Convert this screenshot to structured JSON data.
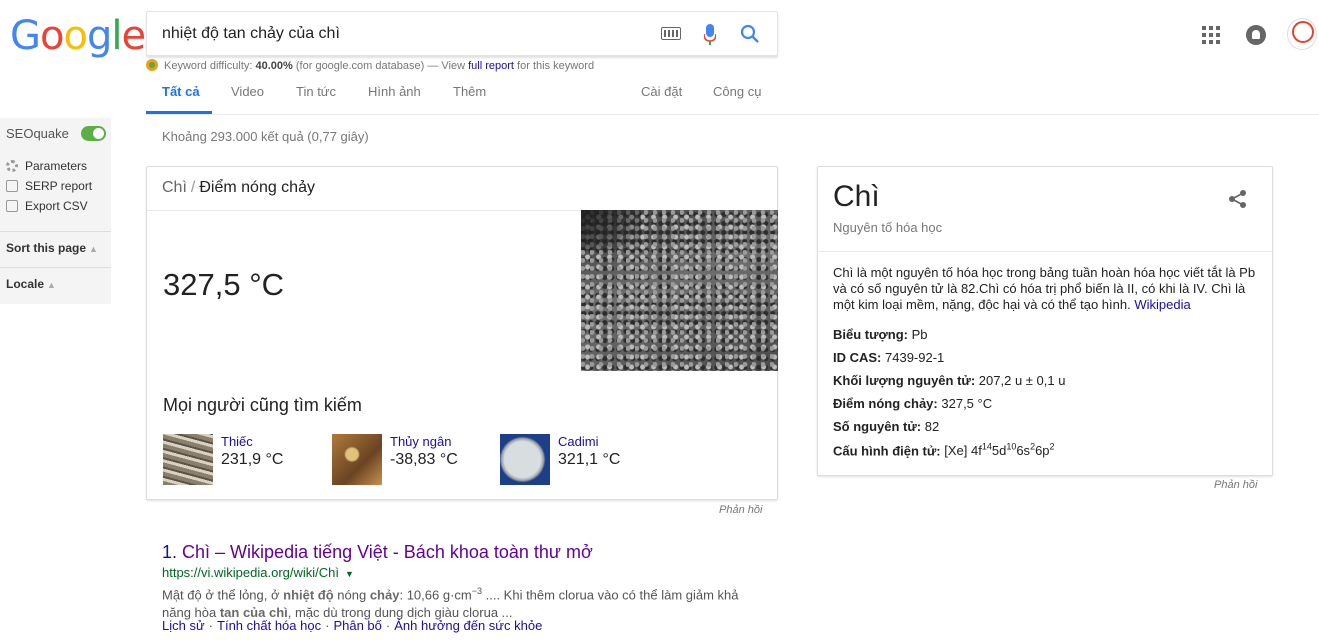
{
  "logo_letters": [
    "G",
    "o",
    "o",
    "g",
    "l",
    "e"
  ],
  "search": {
    "query": "nhiệt độ tan chảy của chì",
    "keyboard_icon": "keyboard-icon",
    "mic_icon": "mic-icon",
    "search_icon": "search-icon"
  },
  "seoquake_bar": {
    "prefix": "Keyword difficulty:",
    "difficulty": "40.00%",
    "middle": "(for google.com database) — View",
    "link": "full report",
    "suffix": "for this keyword"
  },
  "tabs": [
    {
      "label": "Tất cả",
      "active": true
    },
    {
      "label": "Video"
    },
    {
      "label": "Tin tức"
    },
    {
      "label": "Hình ảnh"
    },
    {
      "label": "Thêm"
    },
    {
      "label": "Cài đặt"
    },
    {
      "label": "Công cụ"
    }
  ],
  "sidebar": {
    "title": "SEOquake",
    "items": [
      "Parameters",
      "SERP report",
      "Export CSV"
    ],
    "sections": [
      "Sort this page",
      "Locale"
    ]
  },
  "stats": "Khoảng 293.000 kết quả (0,77 giây)",
  "answer_card": {
    "breadcrumb_parent": "Chì",
    "breadcrumb_sep": "/",
    "breadcrumb_current": "Điểm nóng chảy",
    "answer": "327,5 °C",
    "people_also_search": "Mọi người cũng tìm kiếm",
    "related": [
      {
        "name": "Thiếc",
        "value": "231,9 °C"
      },
      {
        "name": "Thủy ngân",
        "value": "-38,83 °C"
      },
      {
        "name": "Cadimi",
        "value": "321,1 °C"
      }
    ],
    "feedback": "Phản hồi"
  },
  "knowledge_panel": {
    "title": "Chì",
    "subtitle": "Nguyên tố hóa học",
    "description": "Chì là một nguyên tố hóa học trong bảng tuần hoàn hóa học viết tắt là Pb và có số nguyên tử là 82.Chì có hóa trị phổ biến là II, có khi là IV. Chì là một kim loại mềm, nặng, độc hại và có thể tạo hình.",
    "source": "Wikipedia",
    "facts": [
      {
        "label": "Biểu tượng:",
        "value": "Pb"
      },
      {
        "label": "ID CAS:",
        "value": "7439-92-1"
      },
      {
        "label": "Khối lượng nguyên tử:",
        "value": "207,2 u ± 0,1 u"
      },
      {
        "label": "Điểm nóng chảy:",
        "value": "327,5 °C"
      },
      {
        "label": "Số nguyên tử:",
        "value": "82"
      }
    ],
    "config_label": "Cấu hình điện tử:",
    "config_parts": [
      "[Xe] 4f",
      "14",
      "5d",
      "10",
      "6s",
      "2",
      "6p",
      "2"
    ],
    "feedback": "Phản hồi"
  },
  "result": {
    "number": "1.",
    "title": "Chì – Wikipedia tiếng Việt - Bách khoa toàn thư mở",
    "url": "https://vi.wikipedia.org/wiki/Chì",
    "snippet_parts": [
      "Mật độ ở thể lỏng, ở ",
      "nhiệt độ",
      " nóng ",
      "chảy",
      ": 10,66 g·cm",
      "−3",
      " .... Khi thêm clorua vào có thể làm giảm khả năng hòa ",
      "tan của chì",
      ", mặc dù trong dung dịch giàu clorua ..."
    ],
    "sitelinks": [
      "Lịch sử",
      "Tính chất hóa học",
      "Phân bố",
      "Ảnh hưởng đến sức khỏe"
    ]
  }
}
